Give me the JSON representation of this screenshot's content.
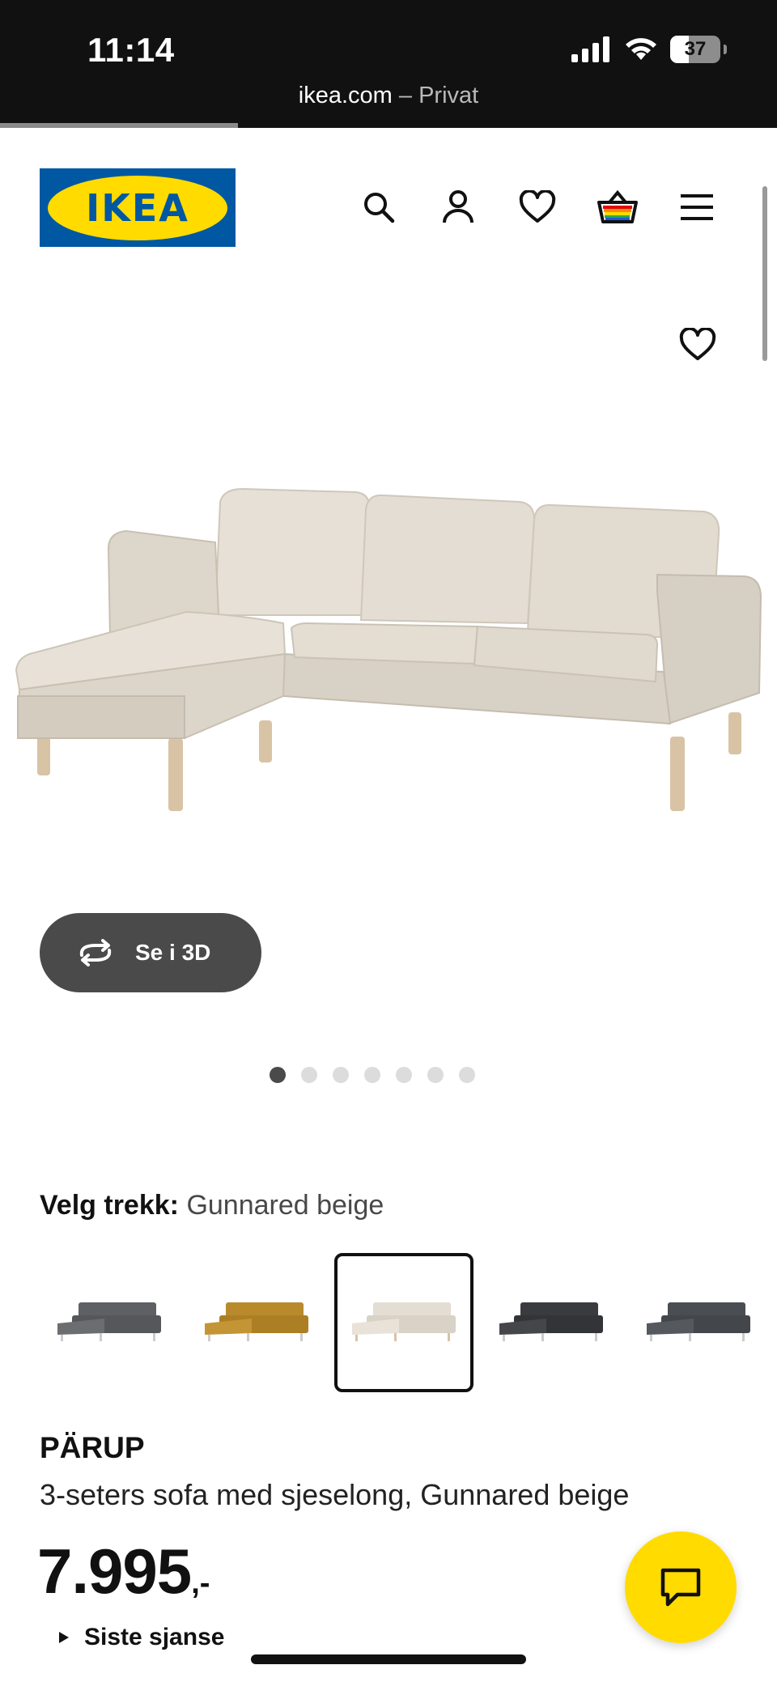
{
  "status_bar": {
    "time": "11:14",
    "battery": "37",
    "url_domain": "ikea.com",
    "url_suffix": " – Privat"
  },
  "header": {
    "logo_text": "IKEA",
    "icons": [
      "search-icon",
      "user-icon",
      "heart-icon",
      "cart-icon",
      "menu-icon"
    ]
  },
  "gallery": {
    "view_3d_label": "Se i 3D",
    "image_count": 7,
    "active_index": 0
  },
  "variants": {
    "label": "Velg trekk:",
    "selected_name": "Gunnared beige",
    "options": [
      {
        "color": "#5e6064"
      },
      {
        "color": "#b98a2c"
      },
      {
        "color": "#ddd6cb",
        "selected": true
      },
      {
        "color": "#3a3b3e"
      },
      {
        "color": "#4a4d52"
      }
    ]
  },
  "product": {
    "brand": "PÄRUP",
    "description": "3-seters sofa med sjeselong, Gunnared beige",
    "price": "7.995",
    "price_suffix": ",-",
    "last_chance": "Siste sjanse"
  },
  "colors": {
    "ikea_blue": "#0058a3",
    "ikea_yellow": "#ffdb00",
    "sofa_beige": "#ddd6cb"
  }
}
